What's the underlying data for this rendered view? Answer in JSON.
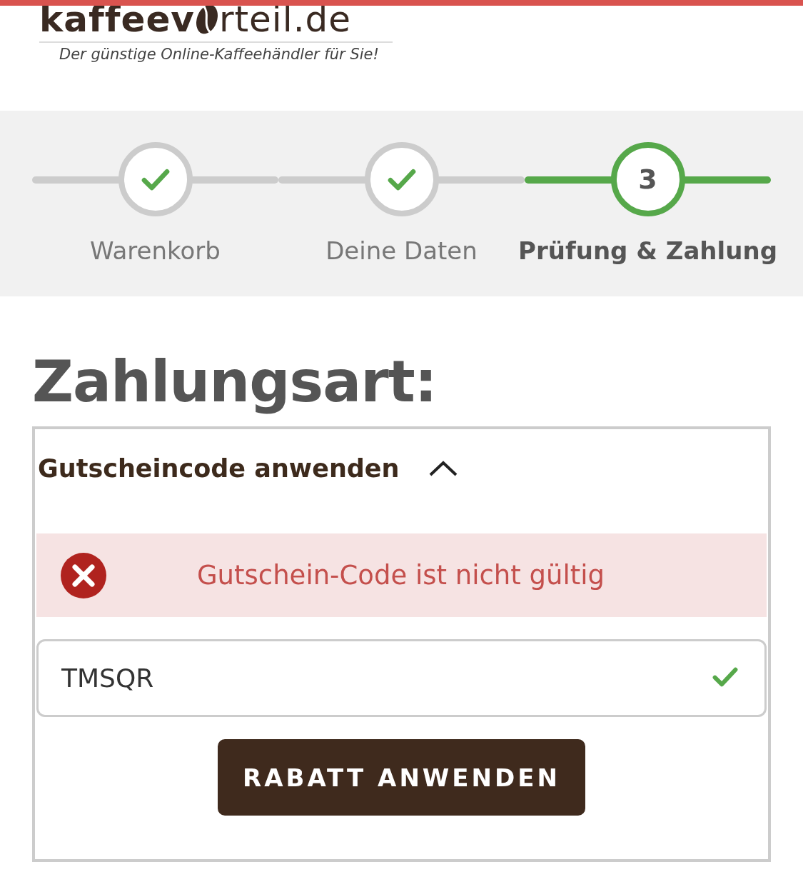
{
  "header": {
    "logo_start": "kaffeev",
    "logo_end": "rteil.de",
    "tagline": "Der günstige Online-Kaffeehändler für Sie!"
  },
  "steps": [
    {
      "label": "Warenkorb",
      "done": true,
      "selected": false
    },
    {
      "label": "Deine Daten",
      "done": true,
      "selected": false
    },
    {
      "label": "Prüfung & Zahlung",
      "done": false,
      "selected": true,
      "number": "3"
    }
  ],
  "heading": "Zahlungsart:",
  "voucher": {
    "title": "Gutscheincode anwenden",
    "expanded": true,
    "alert": {
      "kind": "error",
      "message": "Gutschein-Code ist nicht gültig"
    },
    "input": {
      "value": "TMSQR",
      "valid": true
    },
    "button": "RABATT ANWENDEN"
  }
}
